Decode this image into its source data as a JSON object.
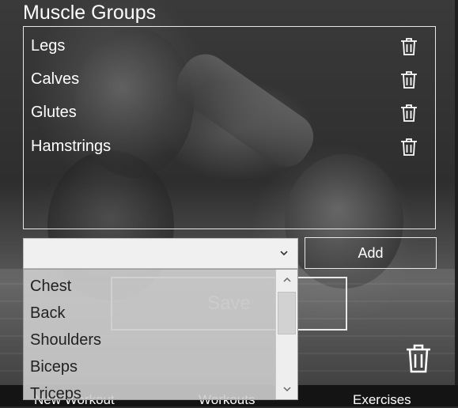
{
  "title": "Muscle Groups",
  "muscle_groups": [
    {
      "label": "Legs"
    },
    {
      "label": "Calves"
    },
    {
      "label": "Glutes"
    },
    {
      "label": "Hamstrings"
    }
  ],
  "combo": {
    "selected": ""
  },
  "add_label": "Add",
  "save_label": "Save",
  "dropdown_options": [
    "Chest",
    "Back",
    "Shoulders",
    "Biceps",
    "Triceps"
  ],
  "nav": {
    "new_workout": "New Workout",
    "workouts": "Workouts",
    "exercises": "Exercises"
  },
  "colors": {
    "text": "#ffffff",
    "border": "#e8e8e8",
    "nav_bg": "#141414",
    "dropdown_bg": "#cdcdcd"
  },
  "icons": {
    "delete": "trash-icon",
    "dropdown": "chevron-down-icon",
    "scroll_up": "chevron-up-icon",
    "scroll_down": "chevron-down-icon"
  }
}
